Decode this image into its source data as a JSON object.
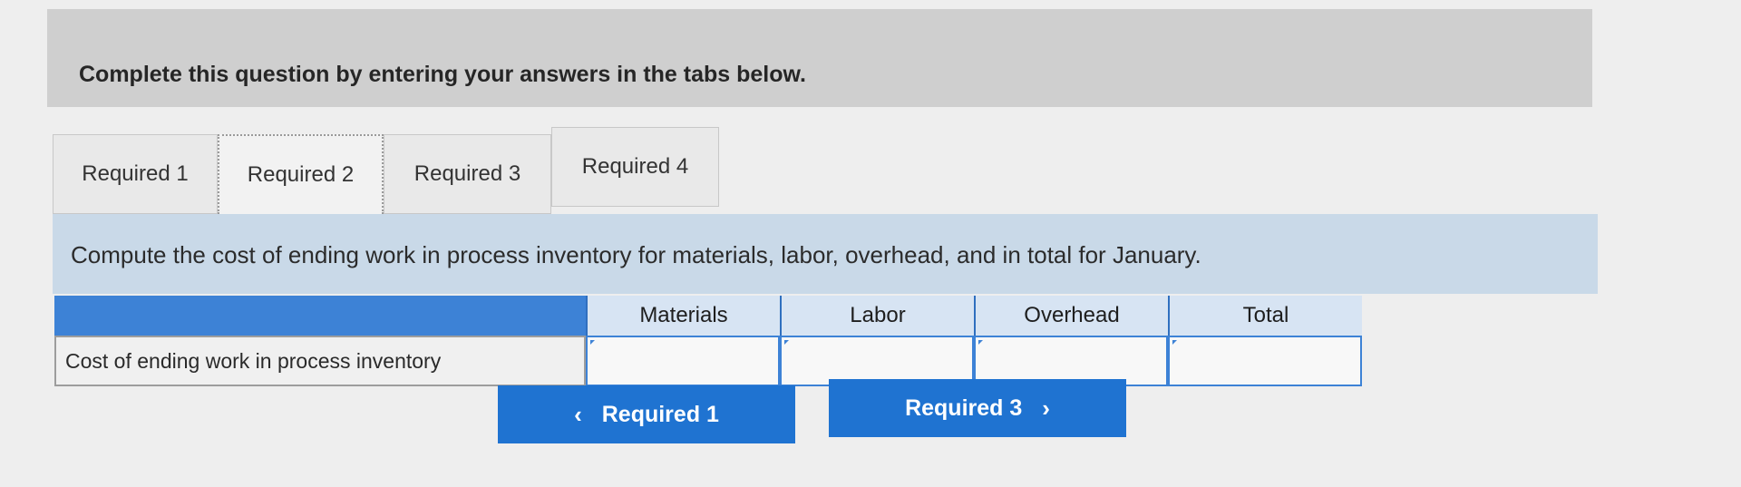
{
  "banner": {
    "text": "Complete this question by entering your answers in the tabs below."
  },
  "tabs": [
    {
      "label": "Required 1"
    },
    {
      "label": "Required 2"
    },
    {
      "label": "Required 3"
    },
    {
      "label": "Required 4"
    }
  ],
  "active_tab": "Required 2",
  "instruction": "Compute the cost of ending work in process inventory for materials, labor, overhead, and in total for January.",
  "table": {
    "columns": [
      "Materials",
      "Labor",
      "Overhead",
      "Total"
    ],
    "rows": [
      {
        "label": "Cost of ending work in process inventory",
        "values": [
          "",
          "",
          "",
          ""
        ]
      }
    ]
  },
  "nav": {
    "prev_label": "Required 1",
    "next_label": "Required 3",
    "prev_icon": "chevron-left-icon",
    "next_icon": "chevron-right-icon"
  },
  "colors": {
    "accent": "#1f73d1",
    "header": "#3d82d6",
    "instruction_bg": "#c9d9e8"
  }
}
